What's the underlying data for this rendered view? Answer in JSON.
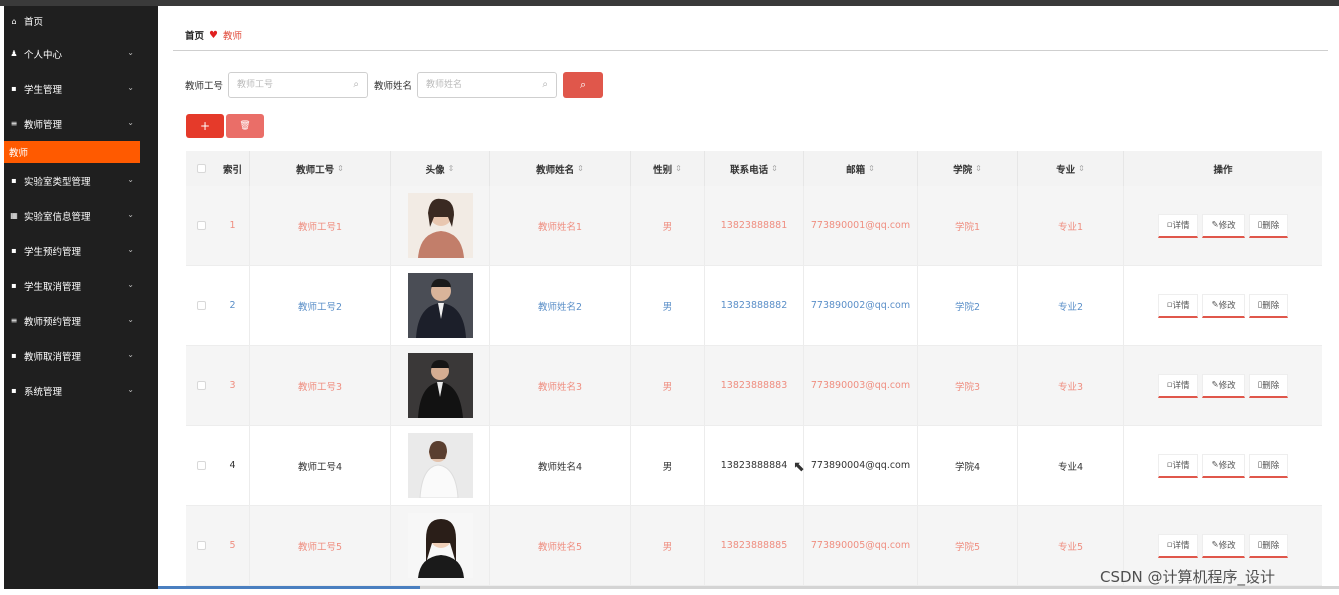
{
  "sidebar": {
    "items": [
      {
        "icon": "home-icon",
        "glyph": "⌂",
        "label": "首页",
        "expandable": false
      },
      {
        "icon": "person-icon",
        "glyph": "♟",
        "label": "个人中心",
        "expandable": true
      },
      {
        "icon": "grid-icon",
        "glyph": "▪",
        "label": "学生管理",
        "expandable": true
      },
      {
        "icon": "list-icon",
        "glyph": "≡",
        "label": "教师管理",
        "expandable": true
      },
      {
        "icon": "flask-icon",
        "glyph": "▪",
        "label": "实验室类型管理",
        "expandable": true
      },
      {
        "icon": "table-icon",
        "glyph": "▦",
        "label": "实验室信息管理",
        "expandable": true
      },
      {
        "icon": "grid-icon",
        "glyph": "▪",
        "label": "学生预约管理",
        "expandable": true
      },
      {
        "icon": "grid-icon",
        "glyph": "▪",
        "label": "学生取消管理",
        "expandable": true
      },
      {
        "icon": "list-icon",
        "glyph": "≡",
        "label": "教师预约管理",
        "expandable": true
      },
      {
        "icon": "grid-icon",
        "glyph": "▪",
        "label": "教师取消管理",
        "expandable": true
      },
      {
        "icon": "grid-icon",
        "glyph": "▪",
        "label": "系统管理",
        "expandable": true
      }
    ],
    "active_sub": "教师"
  },
  "breadcrumb": {
    "home": "首页",
    "current": "教师"
  },
  "search": {
    "field1_label": "教师工号",
    "field1_placeholder": "教师工号",
    "field2_label": "教师姓名",
    "field2_placeholder": "教师姓名"
  },
  "table": {
    "headers": [
      "索引",
      "教师工号",
      "头像",
      "教师姓名",
      "性别",
      "联系电话",
      "邮箱",
      "学院",
      "专业",
      "操作"
    ],
    "rows": [
      {
        "index": "1",
        "gonghao": "教师工号1",
        "name": "教师姓名1",
        "sex": "男",
        "phone": "13823888881",
        "email": "773890001@qq.com",
        "college": "学院1",
        "major": "专业1"
      },
      {
        "index": "2",
        "gonghao": "教师工号2",
        "name": "教师姓名2",
        "sex": "男",
        "phone": "13823888882",
        "email": "773890002@qq.com",
        "college": "学院2",
        "major": "专业2"
      },
      {
        "index": "3",
        "gonghao": "教师工号3",
        "name": "教师姓名3",
        "sex": "男",
        "phone": "13823888883",
        "email": "773890003@qq.com",
        "college": "学院3",
        "major": "专业3"
      },
      {
        "index": "4",
        "gonghao": "教师工号4",
        "name": "教师姓名4",
        "sex": "男",
        "phone": "13823888884",
        "email": "773890004@qq.com",
        "college": "学院4",
        "major": "专业4"
      },
      {
        "index": "5",
        "gonghao": "教师工号5",
        "name": "教师姓名5",
        "sex": "男",
        "phone": "13823888885",
        "email": "773890005@qq.com",
        "college": "学院5",
        "major": "专业5"
      }
    ],
    "ops": {
      "detail": "详情",
      "edit": "修改",
      "delete": "删除"
    }
  },
  "colors": {
    "accent": "#e0574b",
    "sidebar_bg": "#1f1f1f",
    "active_sub": "#ff5a00",
    "odd_text": "#ef8e80",
    "blue_text": "#5b8fc8"
  },
  "watermark": "CSDN @计算机程序_设计"
}
